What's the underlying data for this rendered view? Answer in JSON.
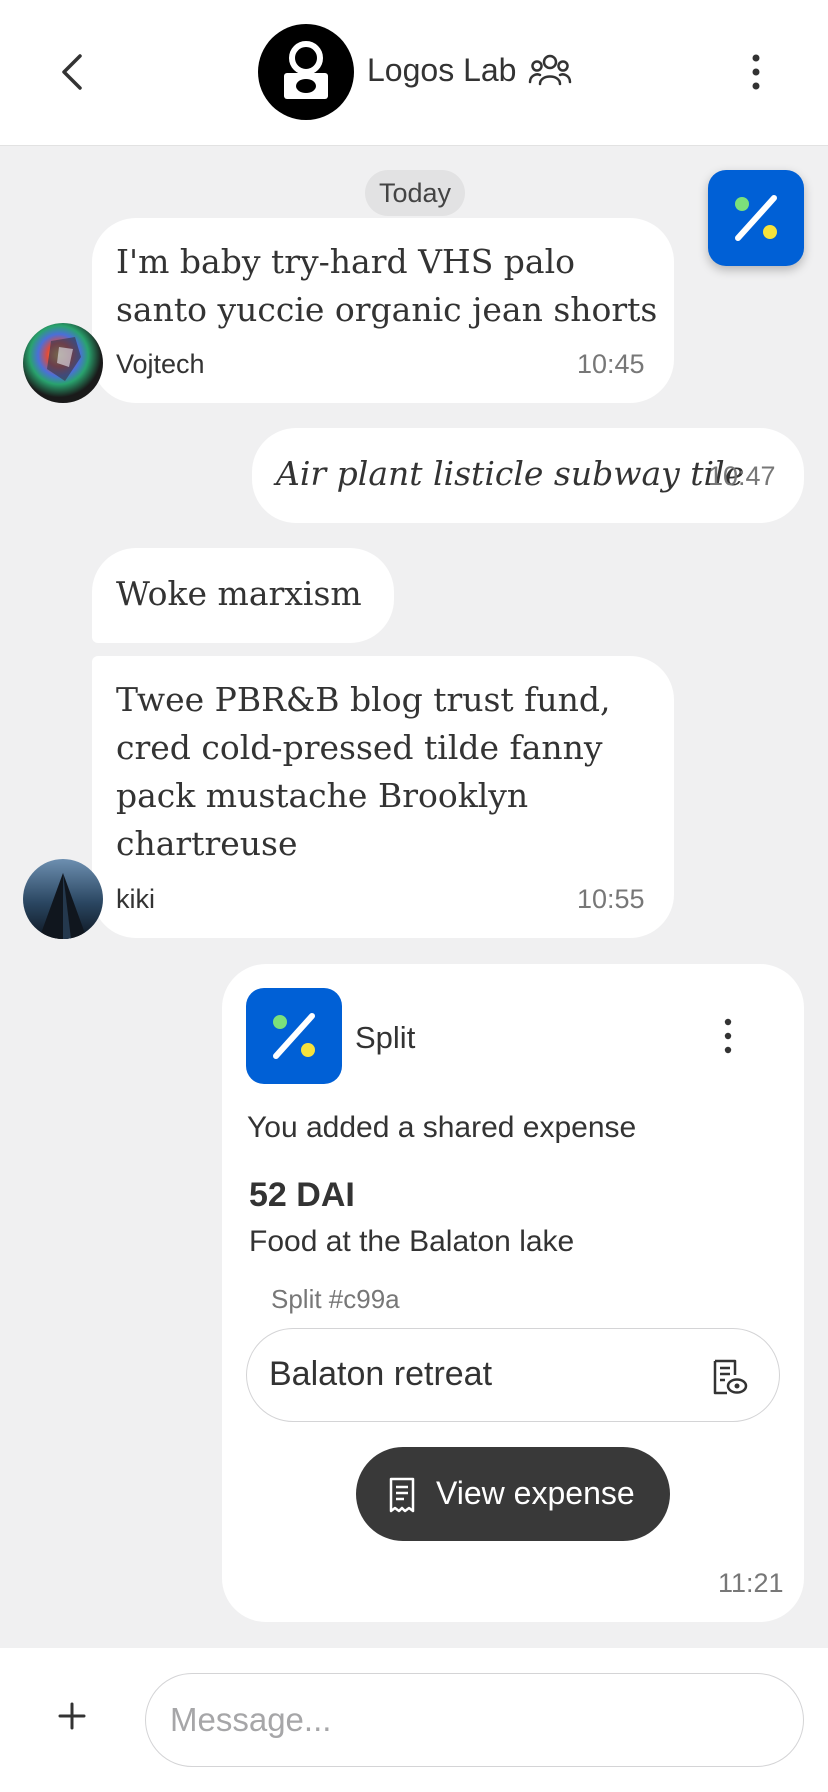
{
  "header": {
    "title": "Logos Lab",
    "back_icon": "chevron-left-icon",
    "group_icon": "people-icon",
    "more_icon": "more-vertical-icon"
  },
  "day_label": "Today",
  "messages": [
    {
      "text_lines": [
        "I'm baby try-hard VHS palo",
        "santo yuccie organic jean shorts"
      ],
      "sender": "Vojtech",
      "time": "10:45",
      "own": false
    },
    {
      "text": "Air plant listicle subway tile",
      "time": "10:47",
      "own": true
    },
    {
      "text": "Woke marxism",
      "own": false
    },
    {
      "text_lines": [
        "Twee PBR&B blog trust fund,",
        "cred cold-pressed tilde fanny",
        "pack mustache Brooklyn",
        "chartreuse"
      ],
      "sender": "kiki",
      "time": "10:55",
      "own": false
    }
  ],
  "expense_card": {
    "app_name": "Split",
    "description": "You added a shared expense",
    "amount": "52 DAI",
    "label": "Food at the Balaton lake",
    "split_id": "Split #c99a",
    "group_name": "Balaton retreat",
    "view_button": "View expense",
    "time": "11:21"
  },
  "composer": {
    "placeholder": "Message..."
  },
  "colors": {
    "accent_blue": "#0060d6",
    "dot_green": "#7be07b",
    "dot_yellow": "#f6e23c",
    "dark_button": "#393939",
    "background": "#f0f0f1"
  }
}
